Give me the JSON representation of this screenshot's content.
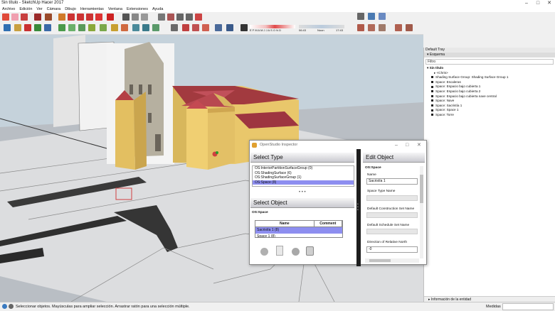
{
  "window": {
    "title": "Sin título - SketchUp Hacer 2017"
  },
  "menu": [
    "Archivo",
    "Edición",
    "Ver",
    "Cámara",
    "Dibujo",
    "Herramientas",
    "Ventana",
    "Extensiones",
    "Ayuda"
  ],
  "toolbar": {
    "shadow_months": "E F M A M J J A S O N D",
    "time_start": "06:43",
    "time_mid": "Noon",
    "time_end": "17:43"
  },
  "tray": {
    "header": "Default Tray",
    "section": "Esquema",
    "filter_placeholder": "Filtro",
    "root": "Sin título",
    "items": [
      "<Chris>",
      "Shading Surface Group: Shading Surface Group 1",
      "Space: Escaleras",
      "Space: Espacio bajo cubierta 1",
      "Space: Espacio bajo cubierta 2",
      "Space: Espacio bajo cubierta nave central",
      "Space: Nave",
      "Space: Sacristía 1",
      "Space: Space 1",
      "Space: Torre"
    ],
    "entity_info": "Información de la entidad"
  },
  "inspector": {
    "title": "OpenStudio Inspector",
    "select_type_head": "Select Type",
    "types": [
      "OS:InteriorPartitionSurfaceGroup (0)",
      "OS:ShadingSurface (6)",
      "OS:ShadingSurfaceGroup (1)",
      "OS:Space (8)"
    ],
    "select_object_head": "Select Object",
    "object_class": "OS:Space",
    "table_headers": [
      "Name",
      "Comment"
    ],
    "rows": [
      "Sacristía 1 (8)",
      "Space 1 (8)"
    ],
    "edit_head": "Edit Object",
    "edit_class": "OS:Space",
    "name_label": "Name",
    "name_value": "Sacristía 1",
    "space_type_label": "Space Type Name",
    "construction_label": "Default Construction Set Name",
    "schedule_label": "Default Schedule Set Name",
    "north_label": "Direction of Relative North",
    "north_value": "-0"
  },
  "status": {
    "message": "Seleccionar objetos. Mayúsculas para ampliar selección. Arrastrar ratón para una selección múltiple.",
    "measure_label": "Medidas"
  },
  "colors": {
    "selection": "#8d8ef0",
    "roof": "#a23a3f",
    "wall": "#e9c76b"
  }
}
